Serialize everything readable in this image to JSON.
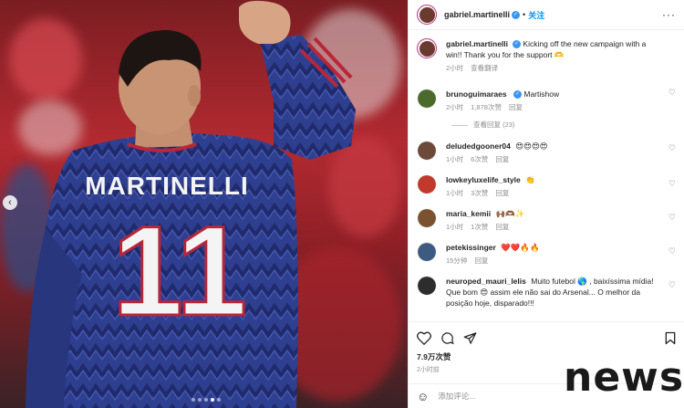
{
  "post": {
    "username": "gabriel.martinelli",
    "follow_label": "关注",
    "caption": "Kicking off the new campaign with a win!! Thank you for the support 🫶",
    "caption_time": "2小时",
    "translate_label": "查看翻译",
    "likes": "7.9万次赞",
    "time": "2小时前",
    "add_comment_placeholder": "添加评论...",
    "carousel": {
      "slides": 5,
      "active": 4
    }
  },
  "jersey": {
    "name": "MARTINELLI",
    "number": "11"
  },
  "comments": [
    {
      "username": "brunoguimaraes",
      "text": "Martishow",
      "time": "2小时",
      "likes": "1,878次赞",
      "reply": "回复",
      "view_replies": "查看回复 (23)",
      "avatar_color": "#4a6b2c"
    },
    {
      "username": "deludedgooner04",
      "text": "😍😍😍😍",
      "time": "1小时",
      "likes": "6次赞",
      "reply": "回复",
      "avatar_color": "#6b4a3a"
    },
    {
      "username": "lowkeyluxelife_style",
      "text": "👏",
      "time": "1小时",
      "likes": "3次赞",
      "reply": "回复",
      "avatar_color": "#c0392b"
    },
    {
      "username": "maria_kemii",
      "text": "🙌🏾🫶🏾✨",
      "time": "1小时",
      "likes": "1次赞",
      "reply": "回复",
      "avatar_color": "#7a5230"
    },
    {
      "username": "petekissinger",
      "text": "❤️❤️🔥🔥",
      "time": "15分钟",
      "likes": "",
      "reply": "回复",
      "avatar_color": "#3d5a80"
    },
    {
      "username": "neuroped_mauri_lelis",
      "text": "Muito futebol 🌎 , baixíssima mídia! Que bom 😍 assim ele não sai do Arsenal... O melhor da posição hoje, disparado!!!",
      "time": "",
      "likes": "",
      "reply": "",
      "avatar_color": "#2d2d2d"
    }
  ],
  "watermark": "news",
  "colors": {
    "link": "#0095f6",
    "verified": "#3897f0",
    "muted": "#8e8e8e"
  }
}
